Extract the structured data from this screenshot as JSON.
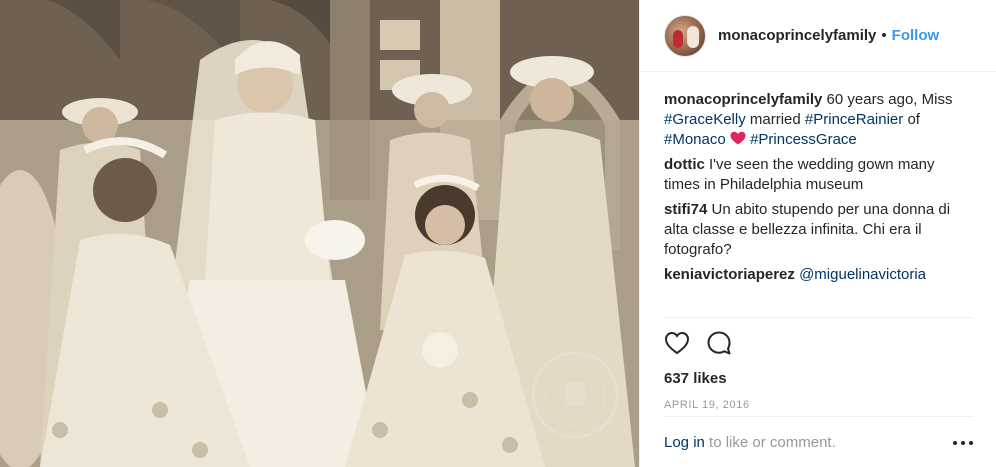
{
  "post": {
    "username": "monacoprincelyfamily",
    "header_separator": "•",
    "follow_label": "Follow",
    "photo_caption_image": "wedding-photo",
    "comments": [
      {
        "user": "monacoprincelyfamily",
        "parts": [
          {
            "text": " 60 years ago, Miss ",
            "tag": false
          },
          {
            "text": "#GraceKelly",
            "tag": true
          },
          {
            "text": " married ",
            "tag": false
          },
          {
            "text": "#PrinceRainier",
            "tag": true
          },
          {
            "text": " of ",
            "tag": false
          },
          {
            "text": "#Monaco",
            "tag": true
          },
          {
            "text": " ",
            "tag": false
          },
          {
            "text": "HEART",
            "tag": false
          },
          {
            "text": " ",
            "tag": false
          },
          {
            "text": "#PrincessGrace",
            "tag": true
          }
        ]
      },
      {
        "user": "dottic",
        "parts": [
          {
            "text": " I've seen the wedding gown many times in Philadelphia museum",
            "tag": false
          }
        ]
      },
      {
        "user": "stifi74",
        "parts": [
          {
            "text": " Un abito stupendo per una donna di alta classe e bellezza infinita. Chi era il fotografo?",
            "tag": false
          }
        ]
      },
      {
        "user": "keniavictoriaperez",
        "parts": [
          {
            "text": " ",
            "tag": false
          },
          {
            "text": "@miguelinavictoria",
            "tag": true
          }
        ]
      }
    ],
    "likes": "637 likes",
    "date": "APRIL 19, 2016",
    "login_link": "Log in",
    "login_rest": " to like or comment.",
    "photo_stamp_text": "PALAIS PRINCIER DE MONACO"
  },
  "colors": {
    "link": "#003569",
    "follow": "#3897f0",
    "muted": "#999999",
    "text": "#262626",
    "heart_emoji": "#e0245e"
  },
  "icons": {
    "like": "heart-outline-icon",
    "comment": "comment-bubble-icon",
    "more": "more-options-icon"
  }
}
